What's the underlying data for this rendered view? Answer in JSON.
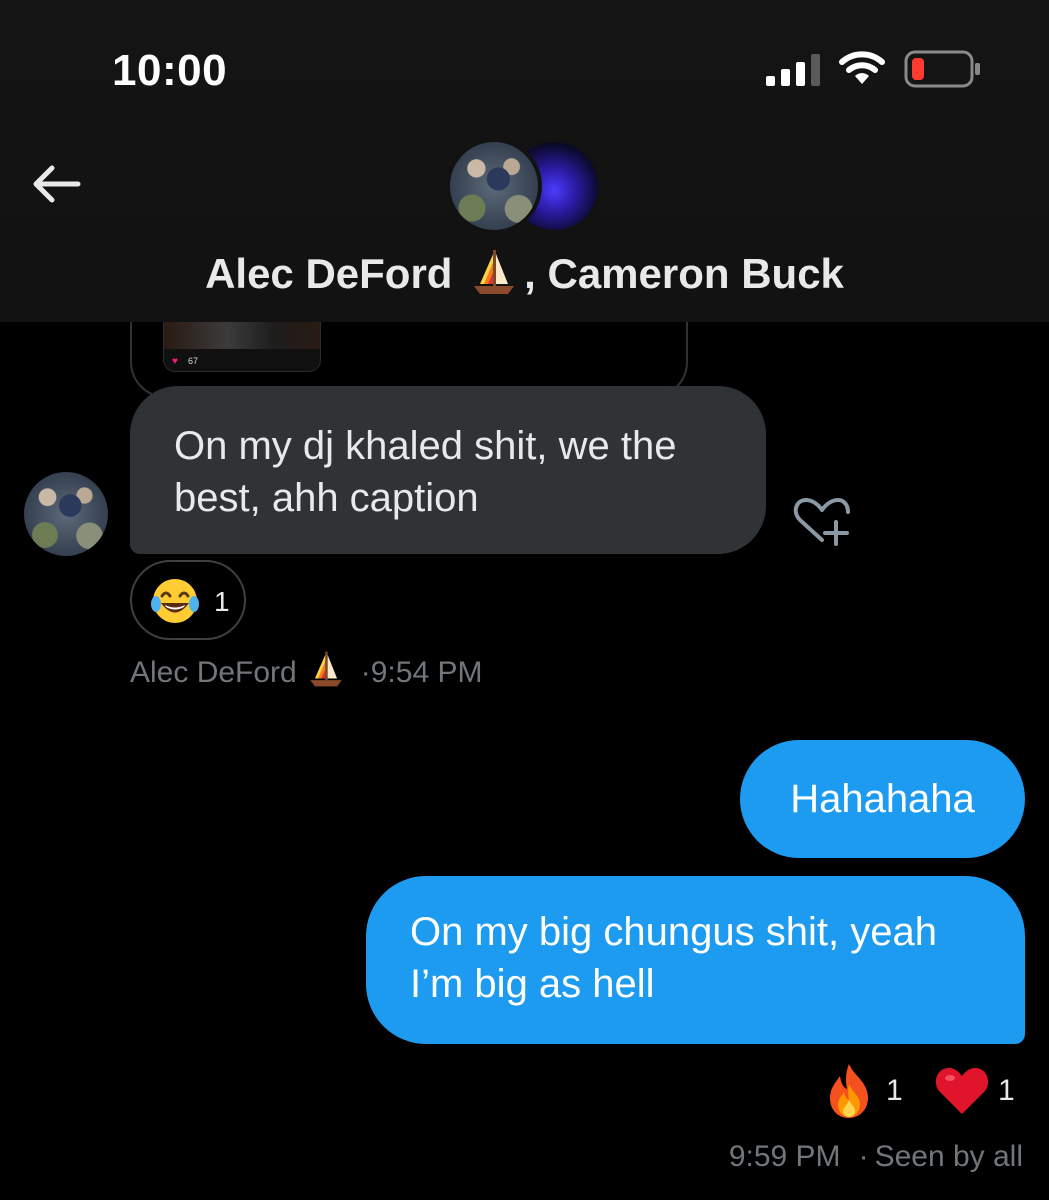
{
  "status_bar": {
    "time": "10:00"
  },
  "header": {
    "title_name_1": "Alec DeFord",
    "title_separator": ", ",
    "title_name_2": "Cameron Buck",
    "back_icon": "back-arrow-icon"
  },
  "quoted_post": {
    "like_count": "67"
  },
  "messages": [
    {
      "direction": "incoming",
      "text": "On my dj khaled shit, we the best, ahh caption",
      "reaction": {
        "emoji": "😂",
        "count": "1"
      },
      "sender": "Alec DeFord",
      "time": "9:54 PM"
    },
    {
      "direction": "outgoing",
      "text": "Hahahaha"
    },
    {
      "direction": "outgoing",
      "text": "On my big chungus shit, yeah I’m big as hell",
      "reactions": [
        {
          "emoji": "🔥",
          "count": "1"
        },
        {
          "emoji": "❤️",
          "count": "1"
        }
      ],
      "time": "9:59 PM",
      "status": "Seen by all"
    }
  ],
  "colors": {
    "accent_blue": "#1d9bf0",
    "incoming_bubble": "#2f3336",
    "muted_text": "#71767b",
    "battery_low": "#ff3b30"
  }
}
